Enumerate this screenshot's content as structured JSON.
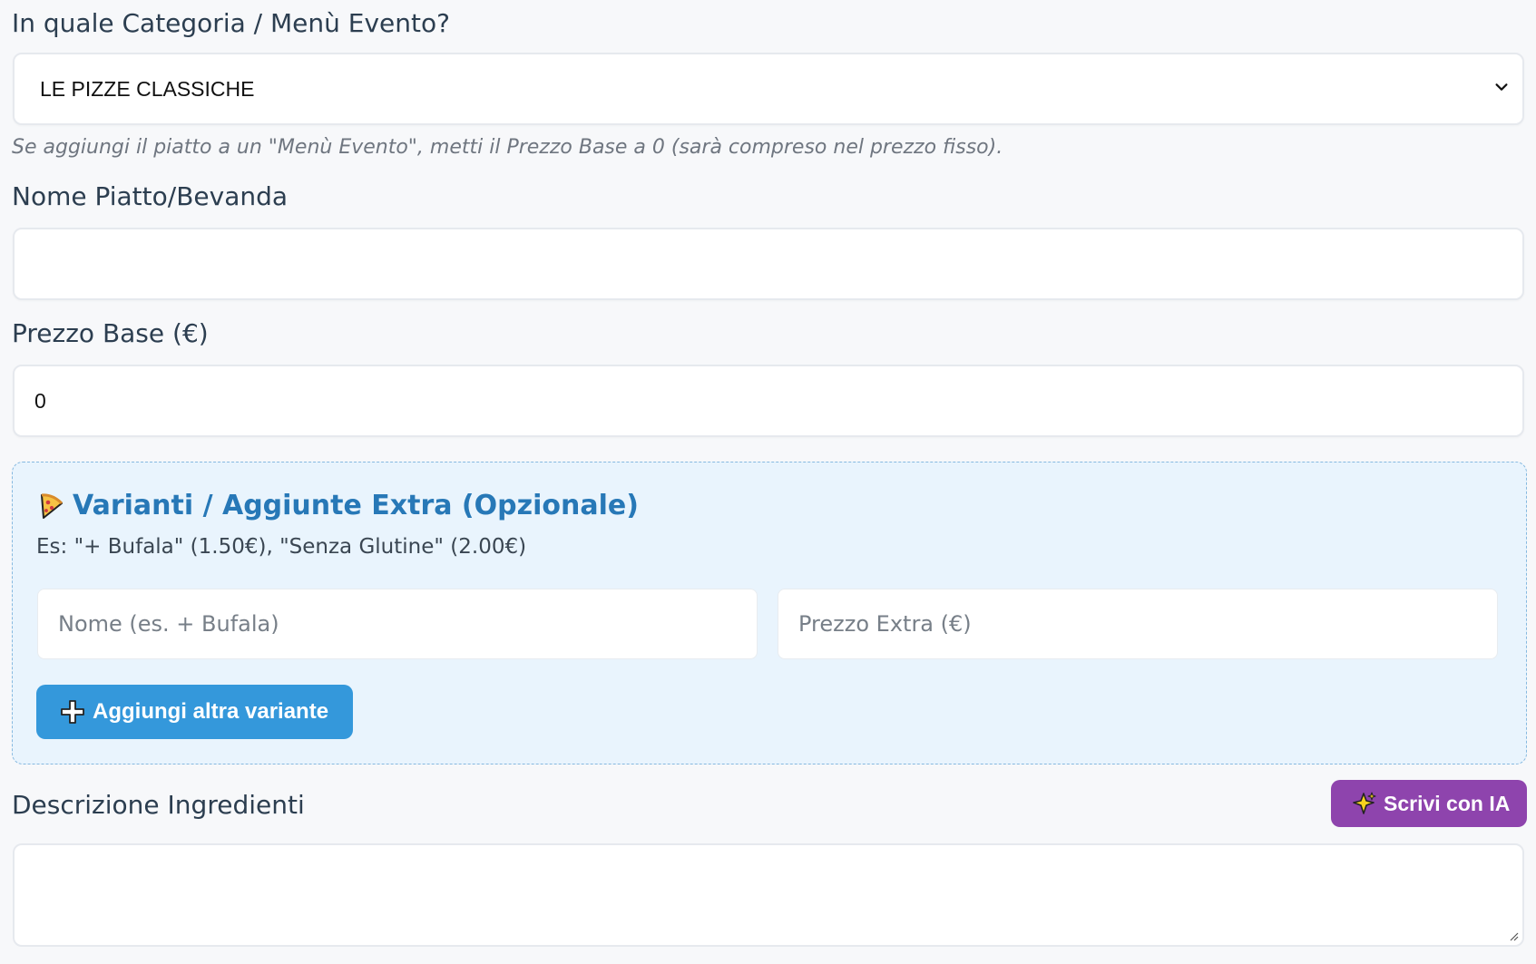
{
  "category": {
    "label": "In quale Categoria / Menù Evento?",
    "selected": "LE PIZZE CLASSICHE",
    "hint": "Se aggiungi il piatto a un \"Menù Evento\", metti il Prezzo Base a 0 (sarà compreso nel prezzo fisso)."
  },
  "dish_name": {
    "label": "Nome Piatto/Bevanda",
    "value": ""
  },
  "base_price": {
    "label": "Prezzo Base (€)",
    "value": "0"
  },
  "variants": {
    "title": "Varianti / Aggiunte Extra (Opzionale)",
    "example": "Es: \"+ Bufala\" (1.50€), \"Senza Glutine\" (2.00€)",
    "name_placeholder": "Nome (es. + Bufala)",
    "price_placeholder": "Prezzo Extra (€)",
    "add_button": "Aggiungi altra variante"
  },
  "description": {
    "label": "Descrizione Ingredienti",
    "ai_button": "Scrivi con IA",
    "value": ""
  },
  "colors": {
    "primary_blue": "#3498db",
    "title_blue": "#2778b7",
    "purple": "#8e44ad",
    "variant_bg": "#e9f4fd"
  },
  "icons": {
    "category_chevron": "chevron-down-icon",
    "variants_title": "pizza-icon",
    "add_button": "plus-icon",
    "ai_button": "sparkle-icon"
  }
}
